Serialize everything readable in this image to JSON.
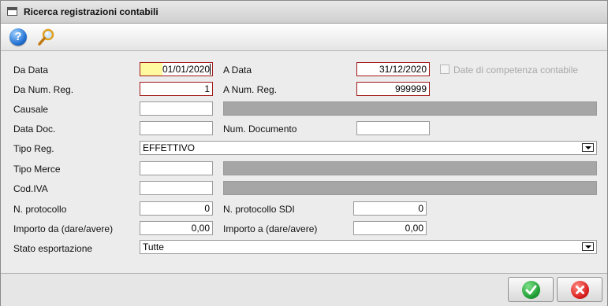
{
  "window": {
    "title": "Ricerca registrazioni contabili"
  },
  "toolbar": {
    "help_icon": "question-mark-icon",
    "search_icon": "magnifier-icon"
  },
  "form": {
    "da_data": {
      "label": "Da Data",
      "value": "01/01/2020"
    },
    "a_data": {
      "label": "A Data",
      "value": "31/12/2020"
    },
    "competenza": {
      "label": "Date di competenza contabile",
      "checked": false
    },
    "da_num_reg": {
      "label": "Da Num. Reg.",
      "value": "1"
    },
    "a_num_reg": {
      "label": "A Num. Reg.",
      "value": "999999"
    },
    "causale": {
      "label": "Causale",
      "value": "",
      "description": ""
    },
    "data_doc": {
      "label": "Data Doc.",
      "value": ""
    },
    "num_documento": {
      "label": "Num. Documento",
      "value": ""
    },
    "tipo_reg": {
      "label": "Tipo Reg.",
      "value": "EFFETTIVO"
    },
    "tipo_merce": {
      "label": "Tipo Merce",
      "value": "",
      "description": ""
    },
    "cod_iva": {
      "label": "Cod.IVA",
      "value": "",
      "description": ""
    },
    "n_protocollo": {
      "label": "N. protocollo",
      "value": "0"
    },
    "n_protocollo_sdi": {
      "label": "N. protocollo SDI",
      "value": "0"
    },
    "importo_da": {
      "label": "Importo da (dare/avere)",
      "value": "0,00"
    },
    "importo_a": {
      "label": "Importo a (dare/avere)",
      "value": "0,00"
    },
    "stato_esportazione": {
      "label": "Stato esportazione",
      "value": "Tutte"
    }
  },
  "buttons": {
    "ok_icon": "checkmark-icon",
    "cancel_icon": "x-icon"
  },
  "colors": {
    "required_border": "#a01818",
    "highlight": "#fff9a0",
    "disabled_field": "#a6a6a6"
  }
}
